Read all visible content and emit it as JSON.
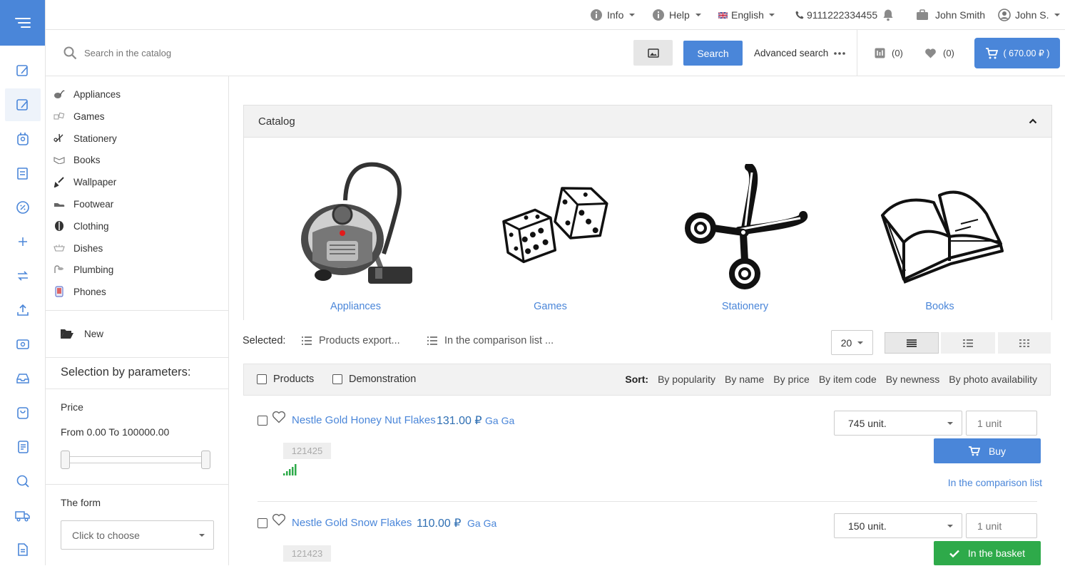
{
  "topbar": {
    "info": "Info",
    "help": "Help",
    "language": "English",
    "phone": "9111222334455",
    "company": "John Smith",
    "user": "John S."
  },
  "search": {
    "placeholder": "Search in the catalog",
    "button": "Search",
    "advanced": "Advanced search",
    "compare_count": "(0)",
    "favorites_count": "(0)",
    "cart_total": "( 670.00 ₽ )"
  },
  "sidebar": {
    "categories": [
      {
        "label": "Appliances",
        "icon": "vacuum-icon"
      },
      {
        "label": "Games",
        "icon": "dice-icon"
      },
      {
        "label": "Stationery",
        "icon": "scissors-icon"
      },
      {
        "label": "Books",
        "icon": "book-icon"
      },
      {
        "label": "Wallpaper",
        "icon": "brush-icon"
      },
      {
        "label": "Footwear",
        "icon": "shoe-icon"
      },
      {
        "label": "Clothing",
        "icon": "clothing-icon"
      },
      {
        "label": "Dishes",
        "icon": "dishes-icon"
      },
      {
        "label": "Plumbing",
        "icon": "shower-icon"
      },
      {
        "label": "Phones",
        "icon": "phone-icon"
      }
    ],
    "new_label": "New",
    "selection_title": "Selection by parameters:",
    "price_label": "Price",
    "price_range": "From 0.00 To 100000.00",
    "price_min": 0,
    "price_max": 100000,
    "form_label": "The form",
    "form_placeholder": "Click to choose"
  },
  "catalog": {
    "title": "Catalog",
    "tiles": [
      {
        "label": "Appliances"
      },
      {
        "label": "Games"
      },
      {
        "label": "Stationery"
      },
      {
        "label": "Books"
      }
    ]
  },
  "toolbar": {
    "selected_label": "Selected:",
    "export_label": "Products export...",
    "compare_label": "In the comparison list ...",
    "page_size": "20"
  },
  "filters": {
    "products_label": "Products",
    "demo_label": "Demonstration",
    "sort_label": "Sort:",
    "sort_options": [
      "By popularity",
      "By name",
      "By price",
      "By item code",
      "By newness",
      "By photo availability"
    ]
  },
  "products": [
    {
      "name": "Nestle Gold Honey Nut Flakes",
      "price": "131.00 ₽",
      "brand": "Ga Ga",
      "code": "121425",
      "stock": "745 unit.",
      "qty_placeholder": "1 unit",
      "action": "Buy",
      "compare": "In the comparison list"
    },
    {
      "name": "Nestle Gold Snow Flakes",
      "price": "110.00 ₽",
      "brand": "Ga Ga",
      "code": "121423",
      "stock": "150 unit.",
      "qty_placeholder": "1 unit",
      "action": "In the basket"
    }
  ],
  "colors": {
    "accent": "#4a86d9",
    "success": "#2eaa4a",
    "link": "#4a86d9"
  }
}
